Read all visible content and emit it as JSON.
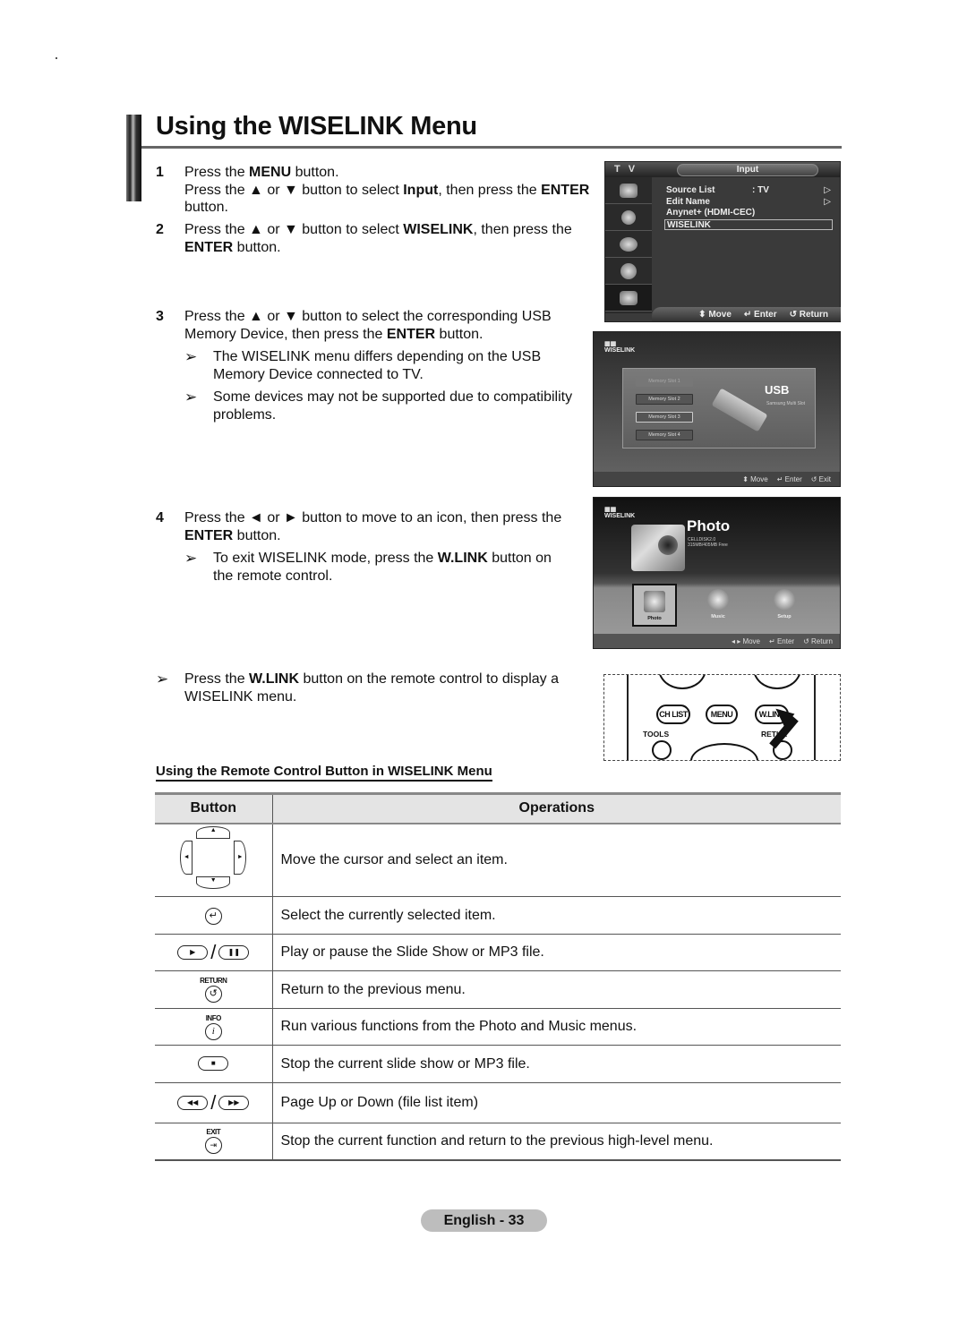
{
  "page": {
    "title": "Using the WISELINK Menu",
    "footer": "English - 33"
  },
  "steps": [
    {
      "num": "1",
      "lines": [
        [
          "Press the ",
          {
            "b": "MENU"
          },
          " button."
        ],
        [
          "Press the ▲ or ▼ button to select ",
          {
            "b": "Input"
          },
          ", then press the ",
          {
            "b": "ENTER"
          },
          " button."
        ]
      ]
    },
    {
      "num": "2",
      "lines": [
        [
          "Press the ▲ or ▼ button to select ",
          {
            "b": "WISELINK"
          },
          ", then press the ",
          {
            "b": "ENTER"
          },
          " button."
        ]
      ]
    },
    {
      "num": "3",
      "lines": [
        [
          "Press the ▲ or ▼ button to select the corresponding USB Memory Device, then press the ",
          {
            "b": "ENTER"
          },
          " button."
        ]
      ],
      "notes": [
        "The WISELINK menu differs depending on the USB Memory Device connected to TV.",
        "Some devices may not be supported due to compatibility problems."
      ]
    },
    {
      "num": "4",
      "lines": [
        [
          "Press the ◄ or ► button to move to an icon, then press the ",
          {
            "b": "ENTER"
          },
          " button."
        ]
      ],
      "notes_rich": [
        [
          "To exit WISELINK mode, press the ",
          {
            "b": "W.LINK"
          },
          " button on the remote control."
        ]
      ]
    }
  ],
  "general_note": [
    "Press the ",
    {
      "b": "W.LINK"
    },
    " button on the remote control to display a WISELINK menu."
  ],
  "note_arrow": "➢",
  "tv_input_menu": {
    "mode": "T V",
    "tab": "Input",
    "side_icons": [
      "picture-icon",
      "sound-icon",
      "channel-icon",
      "setup-icon",
      "input-icon"
    ],
    "items": [
      {
        "label": "Source List",
        "value": ": TV",
        "chevron": "▷"
      },
      {
        "label": "Edit Name",
        "value": "",
        "chevron": "▷"
      },
      {
        "label": "Anynet+ (HDMI-CEC)",
        "value": "",
        "chevron": ""
      },
      {
        "label": "WISELINK",
        "value": "",
        "chevron": "",
        "selected": true
      }
    ],
    "footer": {
      "move": "⬍ Move",
      "enter": "↵ Enter",
      "return": "↺ Return"
    }
  },
  "tv_usb_menu": {
    "logo": "WISELINK",
    "slots": [
      {
        "label": "Memory Slot 1",
        "state": "disabled"
      },
      {
        "label": "Memory Slot 2",
        "state": "normal"
      },
      {
        "label": "Memory Slot 3",
        "state": "selected"
      },
      {
        "label": "Memory Slot 4",
        "state": "normal"
      }
    ],
    "device_title": "USB",
    "device_sub": "Samsung Multi Slot",
    "footer": {
      "move": "⬍ Move",
      "enter": "↵ Enter",
      "exit": "↺ Exit"
    }
  },
  "tv_photo_menu": {
    "logo": "WISELINK",
    "title": "Photo",
    "device": "CELLDISK2.0",
    "space": "315MB/405MB Free",
    "icons": [
      {
        "label": "Photo",
        "selected": true
      },
      {
        "label": "Music",
        "selected": false
      },
      {
        "label": "Setup",
        "selected": false
      }
    ],
    "footer": {
      "move": "◂ ▸ Move",
      "enter": "↵ Enter",
      "return": "↺ Return"
    }
  },
  "remote": {
    "buttons": [
      "CH LIST",
      "MENU",
      "W.LINK"
    ],
    "labels": {
      "tools": "TOOLS",
      "return": "RETUR"
    }
  },
  "section": {
    "heading": "Using the Remote Control Button in WISELINK Menu",
    "table": {
      "headers": [
        "Button",
        "Operations"
      ],
      "rows": [
        {
          "button": "direction-pad",
          "operation": "Move the cursor and select an item."
        },
        {
          "button": "enter",
          "operation": "Select the currently selected item."
        },
        {
          "button": "play-pause",
          "operation": "Play or pause the Slide Show or MP3 file."
        },
        {
          "button": "return",
          "label": "RETURN",
          "operation": "Return to the previous menu."
        },
        {
          "button": "info",
          "label": "INFO",
          "operation": "Run various functions from the Photo and Music menus."
        },
        {
          "button": "stop",
          "operation": "Stop the current slide show or MP3 file."
        },
        {
          "button": "rewind-fastforward",
          "operation": "Page Up or Down (file list item)"
        },
        {
          "button": "exit",
          "label": "EXIT",
          "operation": "Stop the current function and return to the previous high-level menu."
        }
      ]
    }
  }
}
